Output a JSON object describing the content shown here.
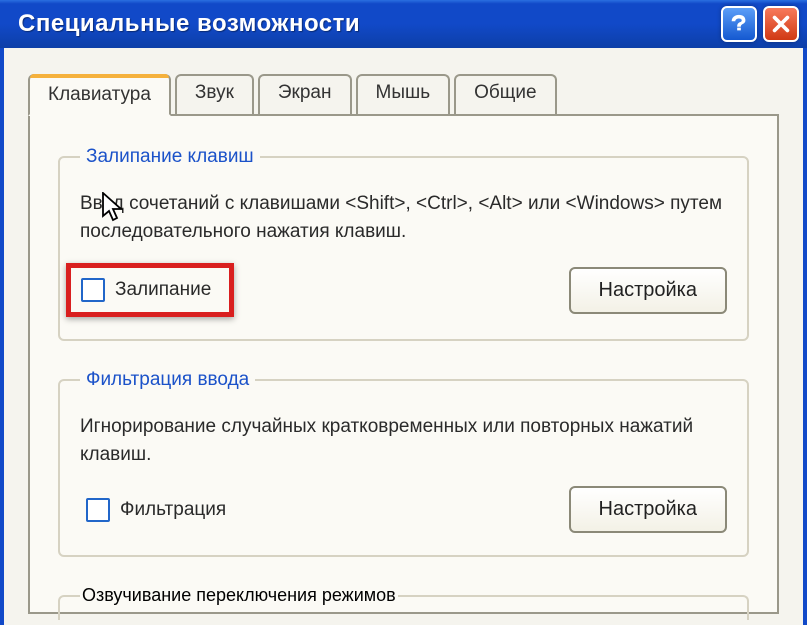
{
  "window": {
    "title": "Специальные возможности"
  },
  "tabs": {
    "t0": "Клавиатура",
    "t1": "Звук",
    "t2": "Экран",
    "t3": "Мышь",
    "t4": "Общие"
  },
  "group_sticky": {
    "legend": "Залипание клавиш",
    "desc": "Ввод сочетаний с клавишами <Shift>, <Ctrl>, <Alt> или <Windows> путем последовательного нажатия клавиш.",
    "checkbox_label": "Залипание",
    "button": "Настройка"
  },
  "group_filter": {
    "legend": "Фильтрация ввода",
    "desc": "Игнорирование случайных кратковременных или повторных нажатий клавиш.",
    "checkbox_label": "Фильтрация",
    "button": "Настройка"
  },
  "group_toggle": {
    "legend": "Озвучивание переключения режимов"
  }
}
